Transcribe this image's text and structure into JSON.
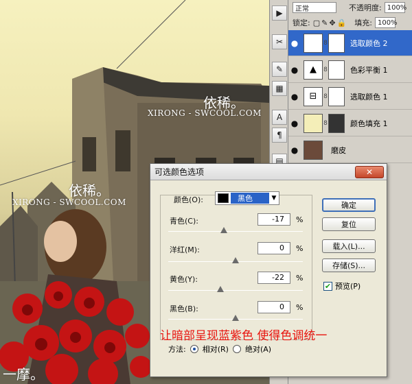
{
  "photo": {
    "watermark_top": {
      "name": "依稀。",
      "site": "XIRONG - SWCOOL.COM"
    },
    "watermark_mid": {
      "name": "依稀。",
      "site": "XIRONG - SWCOOL.COM"
    },
    "watermark_bottom": "一摩。"
  },
  "options": {
    "blend_mode": "正常",
    "opacity_label": "不透明度:",
    "opacity_value": "100%",
    "lock_label": "锁定:",
    "fill_label": "填充:",
    "fill_value": "100%"
  },
  "layers": [
    {
      "name": "选取颜色 2",
      "selected": true,
      "icon": "selective-color-icon"
    },
    {
      "name": "色彩平衡 1",
      "selected": false,
      "icon": "color-balance-icon"
    },
    {
      "name": "选取颜色 1",
      "selected": false,
      "icon": "selective-color-icon"
    },
    {
      "name": "颜色填充 1",
      "selected": false,
      "icon": "color-fill-icon"
    },
    {
      "name": "磨皮",
      "selected": false,
      "icon": "photo-thumb"
    }
  ],
  "dialog": {
    "title": "可选颜色选项",
    "colors_label": "颜色(O):",
    "colors_value": "黑色",
    "swatch_color": "#000000",
    "sliders": [
      {
        "label": "青色(C):",
        "value": "-17",
        "unit": "%",
        "pos": -17
      },
      {
        "label": "洋红(M):",
        "value": "0",
        "unit": "%",
        "pos": 0
      },
      {
        "label": "黄色(Y):",
        "value": "-22",
        "unit": "%",
        "pos": -22
      },
      {
        "label": "黑色(B):",
        "value": "0",
        "unit": "%",
        "pos": 0
      }
    ],
    "buttons": {
      "ok": "确定",
      "reset": "复位",
      "load": "载入(L)...",
      "save": "存储(S)..."
    },
    "preview_label": "预览(P)",
    "preview_checked": true,
    "method_label": "方法:",
    "method_relative": "相对(R)",
    "method_absolute": "绝对(A)",
    "annotation": "让暗部呈现蓝紫色   使得色调统一"
  }
}
